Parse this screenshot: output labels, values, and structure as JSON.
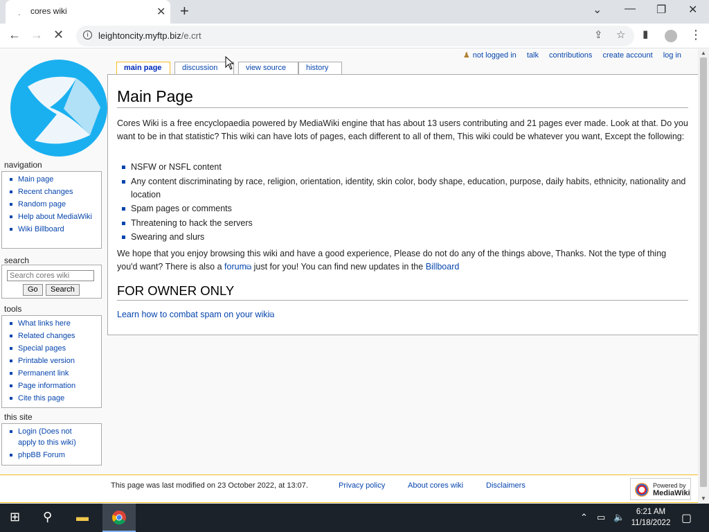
{
  "browser": {
    "tab_title": "cores wiki",
    "url_host": "leightoncity.myftp.biz",
    "url_path": "/e.crt"
  },
  "personal": [
    "not logged in",
    "talk",
    "contributions",
    "create account",
    "log in"
  ],
  "page_tabs": [
    "main page",
    "discussion",
    "view source",
    "history"
  ],
  "content": {
    "title": "Main Page",
    "intro": "Cores Wiki is a free encyclopaedia powered by MediaWiki engine that has about 13 users contributing and 21 pages ever made. Look at that. Do you want to be in that statistic? This wiki can have lots of pages, each different to all of them, This wiki could be whatever you want, Except the following:",
    "rules": [
      "NSFW or NSFL content",
      "Any content discriminating by race, religion, orientation, identity, skin color, body shape, education, purpose, daily habits, ethnicity, nationality and location",
      "Spam pages or comments",
      "Threatening to hack the servers",
      "Swearing and slurs"
    ],
    "outro_before": "We hope that you enjoy browsing this wiki and have a good experience, Please do not do any of the things above, Thanks. Not the type of thing you'd want? There is also a ",
    "outro_link1": "forum",
    "outro_middle": " just for you! You can find new updates in the ",
    "outro_link2": "Billboard",
    "heading2": "FOR OWNER ONLY",
    "spam_link": "Learn how to combat spam on your wiki"
  },
  "sidebar": {
    "navigation_title": "navigation",
    "navigation": [
      "Main page",
      "Recent changes",
      "Random page",
      "Help about MediaWiki",
      "Wiki Billboard"
    ],
    "search_title": "search",
    "search_placeholder": "Search cores wiki",
    "go_label": "Go",
    "search_label": "Search",
    "tools_title": "tools",
    "tools": [
      "What links here",
      "Related changes",
      "Special pages",
      "Printable version",
      "Permanent link",
      "Page information",
      "Cite this page"
    ],
    "site_title": "this site",
    "site": [
      "Login (Does not apply to this wiki)",
      "phpBB Forum"
    ]
  },
  "footer": {
    "last_modified": "This page was last modified on 23 October 2022, at 13:07.",
    "links": [
      "Privacy policy",
      "About cores wiki",
      "Disclaimers"
    ],
    "powered_1": "Powered by",
    "powered_2": "MediaWiki"
  },
  "taskbar": {
    "time": "6:21 AM",
    "date": "11/18/2022"
  },
  "colors": {
    "link": "#0645ad",
    "selected_tab_border": "#fabd23",
    "taskbar": "#1c2229",
    "logo_blue": "#1ab0f0"
  }
}
